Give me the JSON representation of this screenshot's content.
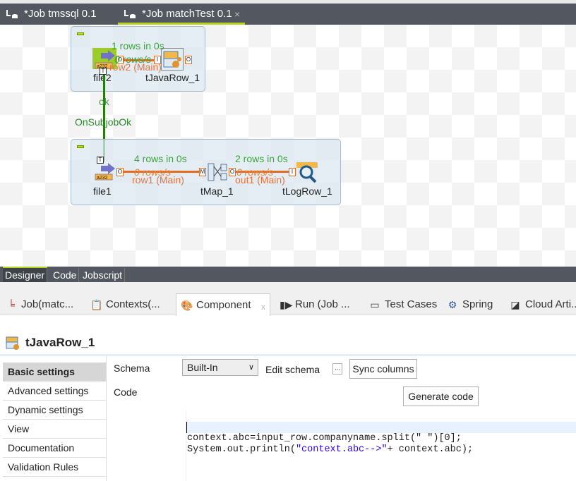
{
  "editor_tabs": [
    {
      "label": "*Job tmssql 0.1",
      "icon": "job-icon",
      "active": false
    },
    {
      "label": "*Job matchTest 0.1",
      "icon": "job-icon",
      "active": true,
      "close": "×"
    }
  ],
  "canvas": {
    "subjob1": {
      "components": [
        {
          "label": "file2",
          "icon": "file-input-icon"
        },
        {
          "label": "tJavaRow_1",
          "icon": "java-row-icon"
        }
      ],
      "connection": {
        "stats": "1 rows in 0s",
        "rate": "0 rows/s",
        "label": "row2 (Main)"
      }
    },
    "trigger": {
      "label1": "ok",
      "label2": "OnSubjobOk"
    },
    "subjob2": {
      "components": [
        {
          "label": "file1",
          "icon": "file-input-icon"
        },
        {
          "label": "tMap_1",
          "icon": "tmap-icon"
        },
        {
          "label": "tLogRow_1",
          "icon": "log-row-icon"
        }
      ],
      "connections": [
        {
          "stats": "4 rows in 0s",
          "rate": "0 rows/s",
          "label": "row1 (Main)"
        },
        {
          "stats": "2 rows in 0s",
          "rate": "0 rows/s",
          "label": "out1 (Main)"
        }
      ]
    },
    "colors": {
      "accent": "#b6d31e",
      "main_link": "#e56b1f",
      "stats": "#3aa53a",
      "trigger_link": "#2a7a12"
    }
  },
  "designer_tabs": [
    "Designer",
    "Code",
    "Jobscript"
  ],
  "view_tabs": [
    {
      "label": "Job(matc...",
      "icon": "job-icon"
    },
    {
      "label": "Contexts(...",
      "icon": "clipboard-icon"
    },
    {
      "label": "Component",
      "icon": "palette-icon",
      "active": true,
      "close": "x"
    },
    {
      "label": "Run (Job ...",
      "icon": "run-icon"
    },
    {
      "label": "Test Cases",
      "icon": "window-icon"
    },
    {
      "label": "Spring",
      "icon": "gear-icon"
    },
    {
      "label": "Cloud Arti...",
      "icon": "cloud-icon"
    }
  ],
  "component": {
    "title": "tJavaRow_1",
    "sidebar": [
      "Basic settings",
      "Advanced settings",
      "Dynamic settings",
      "View",
      "Documentation",
      "Validation Rules"
    ],
    "schema_label": "Schema",
    "schema_value": "Built-In",
    "edit_schema": "Edit schema",
    "ellipsis": "...",
    "sync_columns": "Sync columns",
    "code_label": "Code",
    "generate_code": "Generate code",
    "code": {
      "line1": "",
      "line2": "context.abc=input_row.companyname.split(\" \")[0];",
      "line3a": "System.out.println(",
      "line3b": "\"context.abc-->\"",
      "line3c": "+ context.abc);"
    }
  }
}
